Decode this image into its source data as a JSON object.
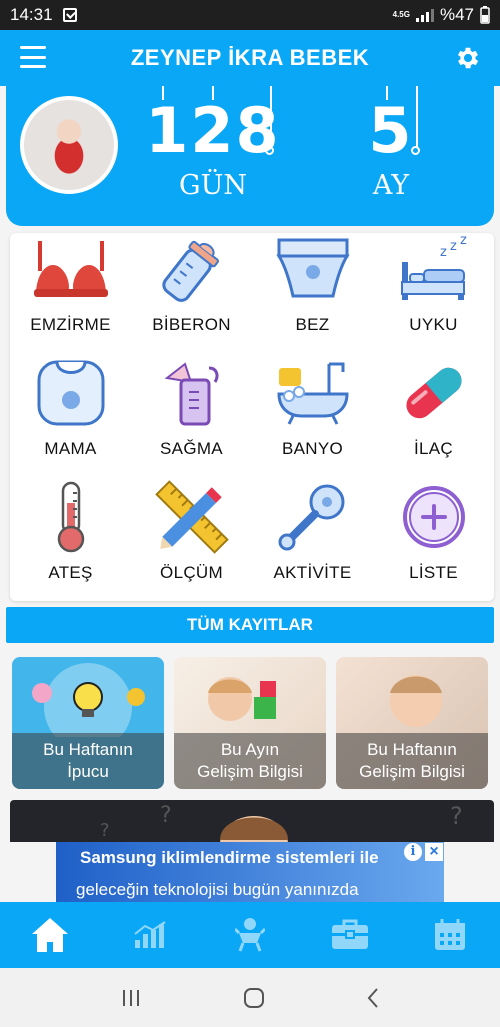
{
  "status_bar": {
    "time": "14:31",
    "network": "4.5G",
    "battery": "%47"
  },
  "header": {
    "title": "ZEYNEP İKRA BEBEK"
  },
  "hero": {
    "days_value": "128",
    "days_unit": "GÜN",
    "months_value": "5",
    "months_unit": "AY"
  },
  "grid": [
    {
      "label": "EMZİRME",
      "icon": "bra-icon"
    },
    {
      "label": "BİBERON",
      "icon": "baby-bottle-icon"
    },
    {
      "label": "BEZ",
      "icon": "diaper-icon"
    },
    {
      "label": "UYKU",
      "icon": "sleep-bed-icon"
    },
    {
      "label": "MAMA",
      "icon": "bib-icon"
    },
    {
      "label": "SAĞMA",
      "icon": "breast-pump-icon"
    },
    {
      "label": "BANYO",
      "icon": "bathtub-icon"
    },
    {
      "label": "İLAÇ",
      "icon": "pill-capsule-icon"
    },
    {
      "label": "ATEŞ",
      "icon": "thermometer-icon"
    },
    {
      "label": "ÖLÇÜM",
      "icon": "ruler-pencil-icon"
    },
    {
      "label": "AKTİVİTE",
      "icon": "rattle-icon"
    },
    {
      "label": "LİSTE",
      "icon": "plus-circle-icon"
    }
  ],
  "all_records_label": "TÜM KAYITLAR",
  "cards": [
    {
      "line1": "Bu Haftanın",
      "line2": "İpucu"
    },
    {
      "line1": "Bu Ayın",
      "line2": "Gelişim Bilgisi"
    },
    {
      "line1": "Bu Haftanın",
      "line2": "Gelişim Bilgisi"
    }
  ],
  "ad": {
    "line1": "Samsung iklimlendirme sistemleri ile",
    "line2": "geleceğin teknolojisi bugün yanınızda"
  },
  "bottom_nav": [
    "home-icon",
    "chart-icon",
    "baby-icon",
    "toolbox-icon",
    "calendar-icon"
  ],
  "colors": {
    "primary": "#09a7f5",
    "white": "#ffffff"
  }
}
